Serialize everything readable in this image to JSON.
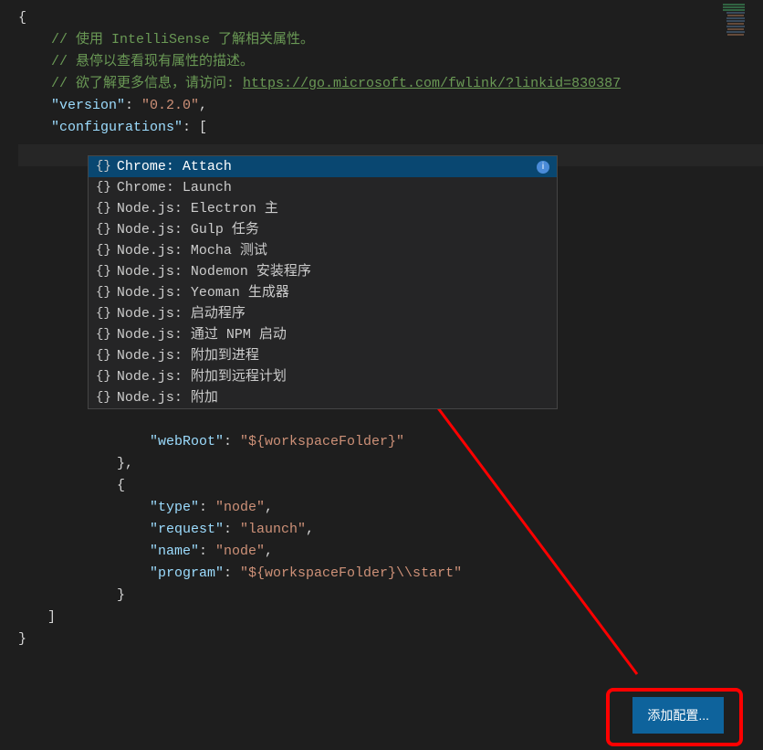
{
  "code": {
    "open_brace": "{",
    "comment1": "// 使用 IntelliSense 了解相关属性。",
    "comment2": "// 悬停以查看现有属性的描述。",
    "comment3_prefix": "// 欲了解更多信息，请访问: ",
    "comment3_link": "https://go.microsoft.com/fwlink/?linkid=830387",
    "version_key": "\"version\"",
    "version_val": "\"0.2.0\"",
    "configs_key": "\"configurations\"",
    "open_bracket": "[",
    "webroot_key": "\"webRoot\"",
    "webroot_val": "\"${workspaceFolder}\"",
    "close_obj1": "},",
    "open_obj2": "{",
    "type_key": "\"type\"",
    "type_val": "\"node\"",
    "request_key": "\"request\"",
    "request_val": "\"launch\"",
    "name_key": "\"name\"",
    "name_val": "\"node\"",
    "program_key": "\"program\"",
    "program_val": "\"${workspaceFolder}\\\\start\"",
    "close_obj2": "}",
    "close_bracket": "]",
    "close_brace": "}",
    "colon": ": ",
    "comma": ","
  },
  "suggestions": [
    "Chrome: Attach",
    "Chrome: Launch",
    "Node.js: Electron 主",
    "Node.js: Gulp 任务",
    "Node.js: Mocha 测试",
    "Node.js: Nodemon 安装程序",
    "Node.js: Yeoman 生成器",
    "Node.js: 启动程序",
    "Node.js: 通过 NPM 启动",
    "Node.js: 附加到进程",
    "Node.js: 附加到远程计划",
    "Node.js: 附加"
  ],
  "icon_text": "{}",
  "info_text": "i",
  "button_label": "添加配置..."
}
